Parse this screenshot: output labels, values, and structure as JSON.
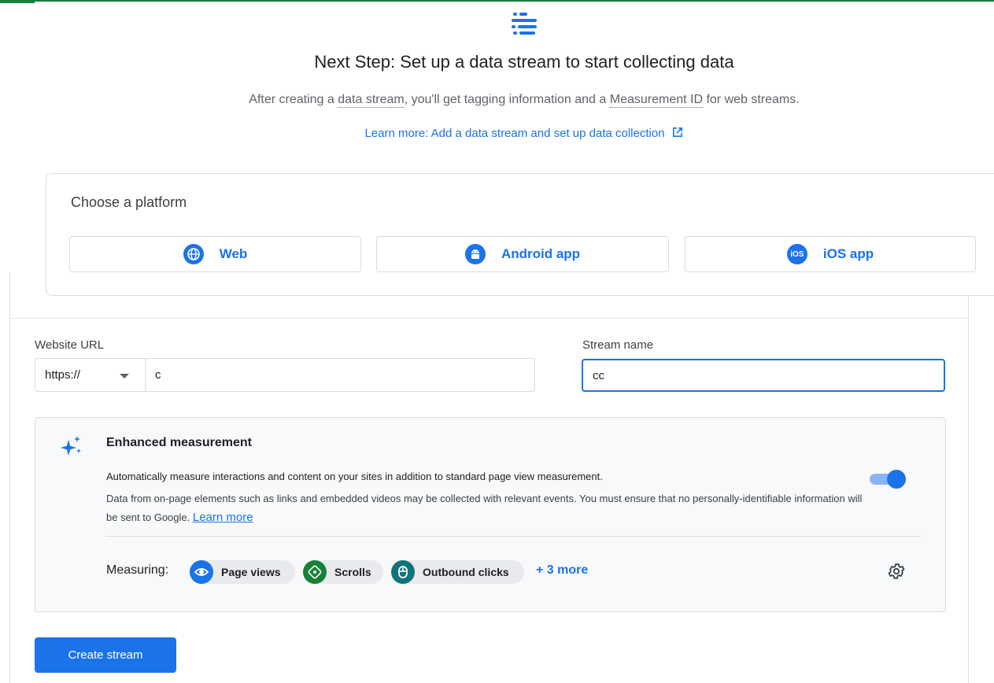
{
  "header": {
    "title": "Next Step: Set up a data stream to start collecting data",
    "subtitle_before": "After creating a ",
    "subtitle_term1": "data stream",
    "subtitle_middle": ", you'll get tagging information and a ",
    "subtitle_term2": "Measurement ID",
    "subtitle_after": " for web streams.",
    "learn_more": "Learn more: Add a data stream and set up data collection"
  },
  "platform": {
    "label": "Choose a platform",
    "options": [
      {
        "label": "Web",
        "icon": "globe-icon"
      },
      {
        "label": "Android app",
        "icon": "android-icon"
      },
      {
        "label": "iOS app",
        "icon": "ios-icon"
      }
    ]
  },
  "form": {
    "website_url_label": "Website URL",
    "protocol": "https://",
    "url_value": "c",
    "stream_name_label": "Stream name",
    "stream_name_value": "cc"
  },
  "enhanced": {
    "title": "Enhanced measurement",
    "line1": "Automatically measure interactions and content on your sites in addition to standard page view measurement.",
    "line2": "Data from on-page elements such as links and embedded videos may be collected with relevant events. You must ensure that no personally-identifiable information will be sent to Google.",
    "learn_more": "Learn more",
    "enabled": true,
    "measuring_label": "Measuring:",
    "chips": [
      {
        "label": "Page views",
        "icon": "eye-icon",
        "color": "#1a73e8"
      },
      {
        "label": "Scrolls",
        "icon": "scroll-target-icon",
        "color": "#188038"
      },
      {
        "label": "Outbound clicks",
        "icon": "mouse-icon",
        "color": "#12737a"
      }
    ],
    "more": "+ 3 more"
  },
  "actions": {
    "create_stream": "Create stream"
  },
  "colors": {
    "accent": "#1a73e8",
    "top_bar": "#188038"
  }
}
